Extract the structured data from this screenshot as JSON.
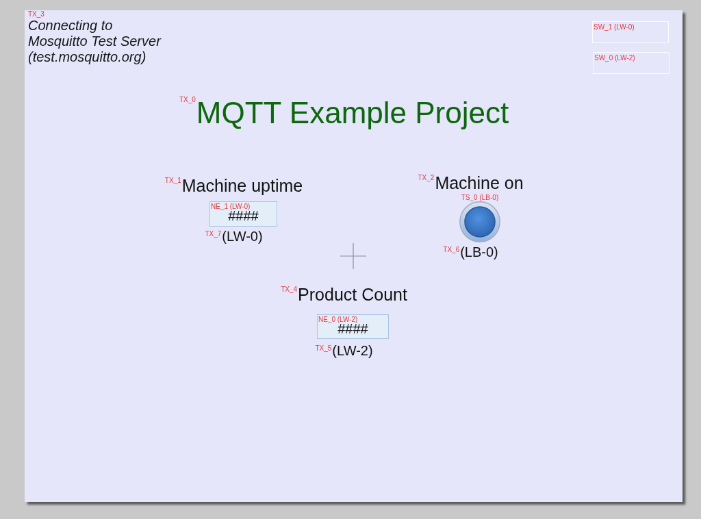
{
  "canvas": {
    "objects": [
      {
        "kind": "note",
        "tag": "TX_3",
        "text": "Connecting to\nMosquitto Test Server\n(test.mosquitto.org)"
      },
      {
        "kind": "switch",
        "tag": "SW_1 (LW-0)"
      },
      {
        "kind": "switch",
        "tag": "SW_0 (LW-2)"
      },
      {
        "kind": "title",
        "tag": "TX_0",
        "text": "MQTT Example Project"
      },
      {
        "kind": "label",
        "tag": "TX_1",
        "text": "Machine uptime"
      },
      {
        "kind": "label",
        "tag": "TX_2",
        "text": "Machine on"
      },
      {
        "kind": "numeric",
        "tag": "NE_1 (LW-0)",
        "value": "####"
      },
      {
        "kind": "toggle",
        "tag": "TS_0 (LB-0)"
      },
      {
        "kind": "address",
        "tag": "TX_7",
        "text": "(LW-0)"
      },
      {
        "kind": "address",
        "tag": "TX_6",
        "text": "(LB-0)"
      },
      {
        "kind": "label",
        "tag": "TX_4",
        "text": "Product Count"
      },
      {
        "kind": "numeric",
        "tag": "NE_0 (LW-2)",
        "value": "####"
      },
      {
        "kind": "address",
        "tag": "TX_5",
        "text": "(LW-2)"
      }
    ]
  }
}
